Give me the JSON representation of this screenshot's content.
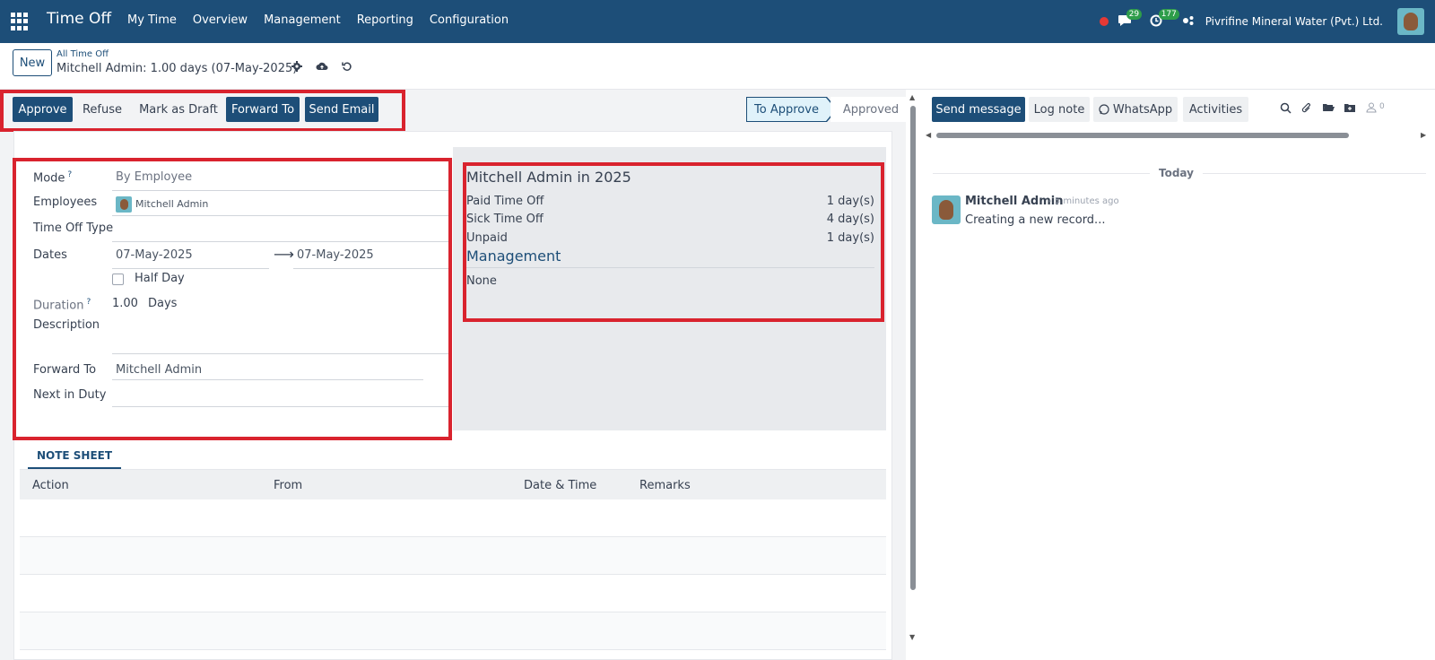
{
  "navbar": {
    "app_title": "Time Off",
    "menu": [
      "My Time",
      "Overview",
      "Management",
      "Reporting",
      "Configuration"
    ],
    "messages_count": "29",
    "activities_count": "177",
    "company": "Pivrifine Mineral Water (Pvt.) Ltd."
  },
  "control": {
    "new_label": "New",
    "breadcrumb_parent": "All Time Off",
    "breadcrumb_current": "Mitchell Admin: 1.00 days (07-May-2025)"
  },
  "actions": {
    "approve": "Approve",
    "refuse": "Refuse",
    "mark_draft": "Mark as Draft",
    "forward_to": "Forward To",
    "send_email": "Send Email"
  },
  "stages": {
    "current": "To Approve",
    "next": "Approved"
  },
  "form": {
    "mode_label": "Mode",
    "mode_value": "By Employee",
    "employees_label": "Employees",
    "employee_value": "Mitchell Admin",
    "type_label": "Time Off Type",
    "dates_label": "Dates",
    "date_from": "07-May-2025",
    "date_to": "07-May-2025",
    "half_day_label": "Half Day",
    "duration_label": "Duration",
    "duration_value": "1.00",
    "duration_unit": "Days",
    "description_label": "Description",
    "forward_label": "Forward To",
    "forward_value": "Mitchell Admin",
    "next_duty_label": "Next in Duty"
  },
  "summary": {
    "title": "Mitchell Admin in 2025",
    "rows": [
      {
        "label": "Paid Time Off",
        "value": "1 day(s)"
      },
      {
        "label": "Sick Time Off",
        "value": "4 day(s)"
      },
      {
        "label": "Unpaid",
        "value": "1 day(s)"
      }
    ],
    "heading": "Management",
    "none": "None"
  },
  "notes": {
    "tab": "NOTE SHEET",
    "columns": [
      "Action",
      "From",
      "Date & Time",
      "Remarks"
    ]
  },
  "chatter": {
    "send_message": "Send message",
    "log_note": "Log note",
    "whatsapp": "WhatsApp",
    "activities": "Activities",
    "followers": "0",
    "today": "Today",
    "author": "Mitchell Admin",
    "time": "- 5 minutes ago",
    "body": "Creating a new record..."
  },
  "colors": {
    "brand": "#1d4e78",
    "highlight": "#d9232e"
  }
}
